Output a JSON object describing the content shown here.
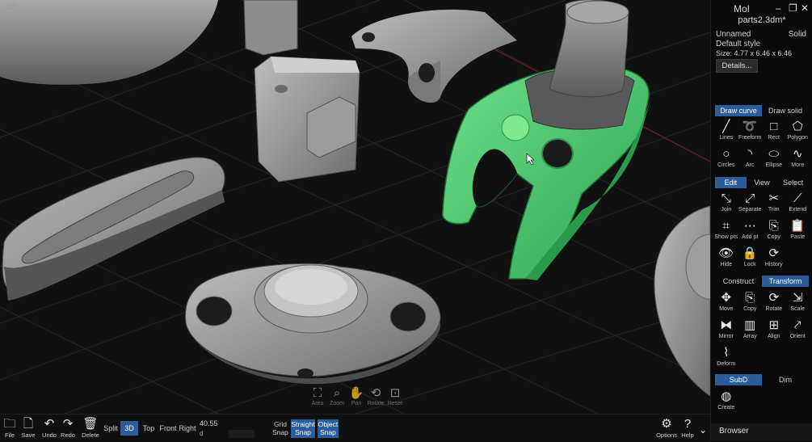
{
  "viewport": {
    "label": "3D",
    "nav_tools": [
      {
        "icon": "zoom-area-icon",
        "label": "Area"
      },
      {
        "icon": "zoom-icon",
        "label": "Zoom"
      },
      {
        "icon": "pan-icon",
        "label": "Pan"
      },
      {
        "icon": "rotate-view-icon",
        "label": "Rotate"
      },
      {
        "icon": "reset-view-icon",
        "label": "Reset"
      }
    ]
  },
  "panel": {
    "app_title": "MoI",
    "file_name": "parts2.3dm*",
    "object_name": "Unnamed",
    "object_type": "Solid",
    "style": "Default style",
    "size": "Size: 4.77 x 6.46 x 6.46",
    "details_label": "Details...",
    "draw_tabs": [
      "Draw curve",
      "Draw solid"
    ],
    "draw_tools": [
      [
        {
          "icon": "line-icon",
          "label": "Lines"
        },
        {
          "icon": "freeform-icon",
          "label": "Freeform"
        },
        {
          "icon": "rect-icon",
          "label": "Rect"
        },
        {
          "icon": "polygon-icon",
          "label": "Polygon"
        }
      ],
      [
        {
          "icon": "circle-icon",
          "label": "Circles"
        },
        {
          "icon": "arc-icon",
          "label": "Arc"
        },
        {
          "icon": "ellipse-icon",
          "label": "Ellipse"
        },
        {
          "icon": "more-icon",
          "label": "More"
        }
      ]
    ],
    "edit_tabs": [
      "Edit",
      "View",
      "Select"
    ],
    "edit_tools": [
      [
        {
          "icon": "join-icon",
          "label": "Join"
        },
        {
          "icon": "separate-icon",
          "label": "Separate"
        },
        {
          "icon": "trim-icon",
          "label": "Trim"
        },
        {
          "icon": "extend-icon",
          "label": "Extend"
        }
      ],
      [
        {
          "icon": "show-points-icon",
          "label": "Show pts"
        },
        {
          "icon": "add-point-icon",
          "label": "Add pt"
        },
        {
          "icon": "copy-icon",
          "label": "Copy"
        },
        {
          "icon": "paste-icon",
          "label": "Paste"
        }
      ],
      [
        {
          "icon": "hide-icon",
          "label": "Hide"
        },
        {
          "icon": "lock-icon",
          "label": "Lock"
        },
        {
          "icon": "history-icon",
          "label": "History"
        }
      ]
    ],
    "transform_tabs": [
      "Construct",
      "Transform"
    ],
    "transform_tools": [
      [
        {
          "icon": "move-icon",
          "label": "Move"
        },
        {
          "icon": "copy-icon",
          "label": "Copy"
        },
        {
          "icon": "rotate-icon",
          "label": "Rotate"
        },
        {
          "icon": "scale-icon",
          "label": "Scale"
        }
      ],
      [
        {
          "icon": "mirror-icon",
          "label": "Mirror"
        },
        {
          "icon": "array-icon",
          "label": "Array"
        },
        {
          "icon": "align-icon",
          "label": "Align"
        },
        {
          "icon": "orient-icon",
          "label": "Orient"
        }
      ],
      [
        {
          "icon": "deform-icon",
          "label": "Deform"
        }
      ]
    ],
    "subd_tabs": [
      "SubD",
      "Dim"
    ],
    "subd_tools": [
      [
        {
          "icon": "subd-create-icon",
          "label": "Create"
        }
      ]
    ],
    "browser_label": "Browser"
  },
  "bottom": {
    "file": "File",
    "save": "Save",
    "undo": "Undo",
    "redo": "Redo",
    "delete": "Delete",
    "views": [
      "Split",
      "3D",
      "Top",
      "Front",
      "Right"
    ],
    "active_view": "3D",
    "coord_value": "40.55",
    "coord_label": "d",
    "grid_snap": "Grid Snap",
    "straight_snap": "Straight Snap",
    "object_snap": "Object Snap",
    "options": "Options",
    "help": "Help"
  },
  "colors": {
    "accent": "#2b5d9c",
    "selected_object": "#3fbf62",
    "background": "#111111"
  }
}
